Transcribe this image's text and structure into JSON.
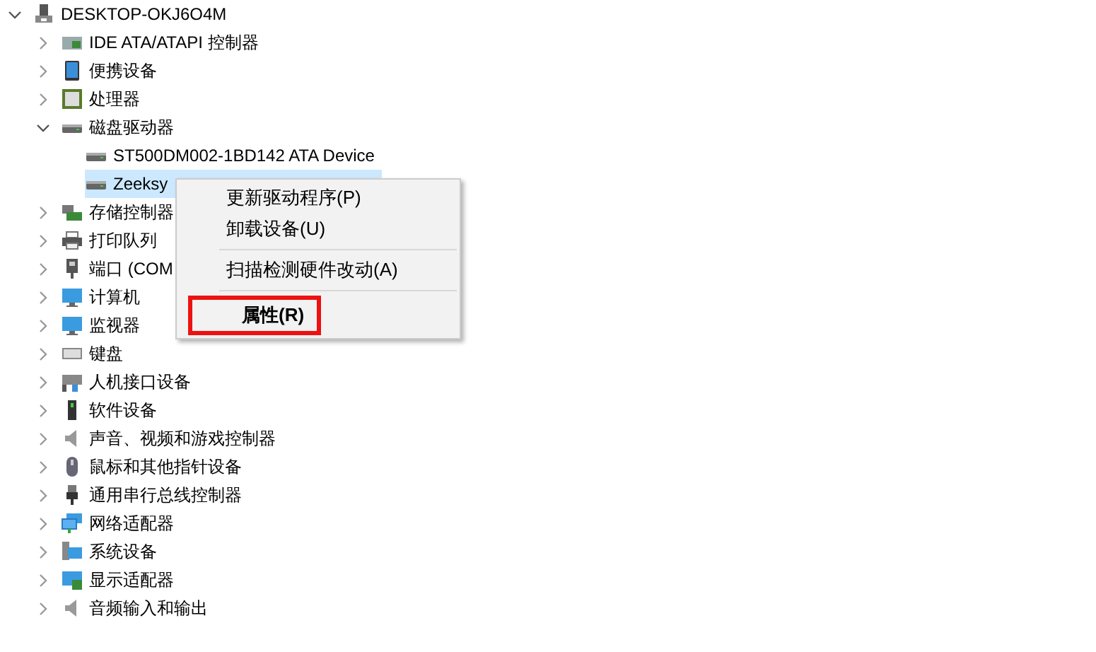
{
  "tree": {
    "label": "DESKTOP-OKJ6O4M",
    "kind": "computer",
    "expanded": true,
    "selected": false,
    "children": [
      {
        "label": "IDE ATA/ATAPI 控制器",
        "kind": "ide",
        "expanded": false,
        "selected": false
      },
      {
        "label": "便携设备",
        "kind": "portable",
        "expanded": false,
        "selected": false
      },
      {
        "label": "处理器",
        "kind": "cpu",
        "expanded": false,
        "selected": false
      },
      {
        "label": "磁盘驱动器",
        "kind": "disk",
        "expanded": true,
        "selected": false,
        "children": [
          {
            "label": "ST500DM002-1BD142 ATA Device",
            "kind": "disk",
            "selected": false
          },
          {
            "label": "Zeeksy",
            "kind": "disk",
            "selected": true
          }
        ]
      },
      {
        "label": "存储控制器",
        "kind": "storage",
        "expanded": false,
        "selected": false
      },
      {
        "label": "打印队列",
        "kind": "printer",
        "expanded": false,
        "selected": false
      },
      {
        "label": "端口 (COM",
        "kind": "port",
        "expanded": false,
        "selected": false
      },
      {
        "label": "计算机",
        "kind": "monitor",
        "expanded": false,
        "selected": false
      },
      {
        "label": "监视器",
        "kind": "monitor",
        "expanded": false,
        "selected": false
      },
      {
        "label": "键盘",
        "kind": "keyboard",
        "expanded": false,
        "selected": false
      },
      {
        "label": "人机接口设备",
        "kind": "hid",
        "expanded": false,
        "selected": false
      },
      {
        "label": "软件设备",
        "kind": "software",
        "expanded": false,
        "selected": false
      },
      {
        "label": "声音、视频和游戏控制器",
        "kind": "sound",
        "expanded": false,
        "selected": false
      },
      {
        "label": "鼠标和其他指针设备",
        "kind": "mouse",
        "expanded": false,
        "selected": false
      },
      {
        "label": "通用串行总线控制器",
        "kind": "usb",
        "expanded": false,
        "selected": false
      },
      {
        "label": "网络适配器",
        "kind": "network",
        "expanded": false,
        "selected": false
      },
      {
        "label": "系统设备",
        "kind": "system",
        "expanded": false,
        "selected": false
      },
      {
        "label": "显示适配器",
        "kind": "display",
        "expanded": false,
        "selected": false
      },
      {
        "label": "音频输入和输出",
        "kind": "sound",
        "expanded": false,
        "selected": false
      }
    ]
  },
  "context_menu": {
    "items": [
      {
        "kind": "item",
        "label": "更新驱动程序(P)",
        "default": false,
        "highlighted": false
      },
      {
        "kind": "item",
        "label": "卸载设备(U)",
        "default": false,
        "highlighted": false
      },
      {
        "kind": "separator"
      },
      {
        "kind": "item",
        "label": "扫描检测硬件改动(A)",
        "default": false,
        "highlighted": false
      },
      {
        "kind": "separator"
      },
      {
        "kind": "item",
        "label": "属性(R)",
        "default": true,
        "highlighted": true
      }
    ]
  }
}
